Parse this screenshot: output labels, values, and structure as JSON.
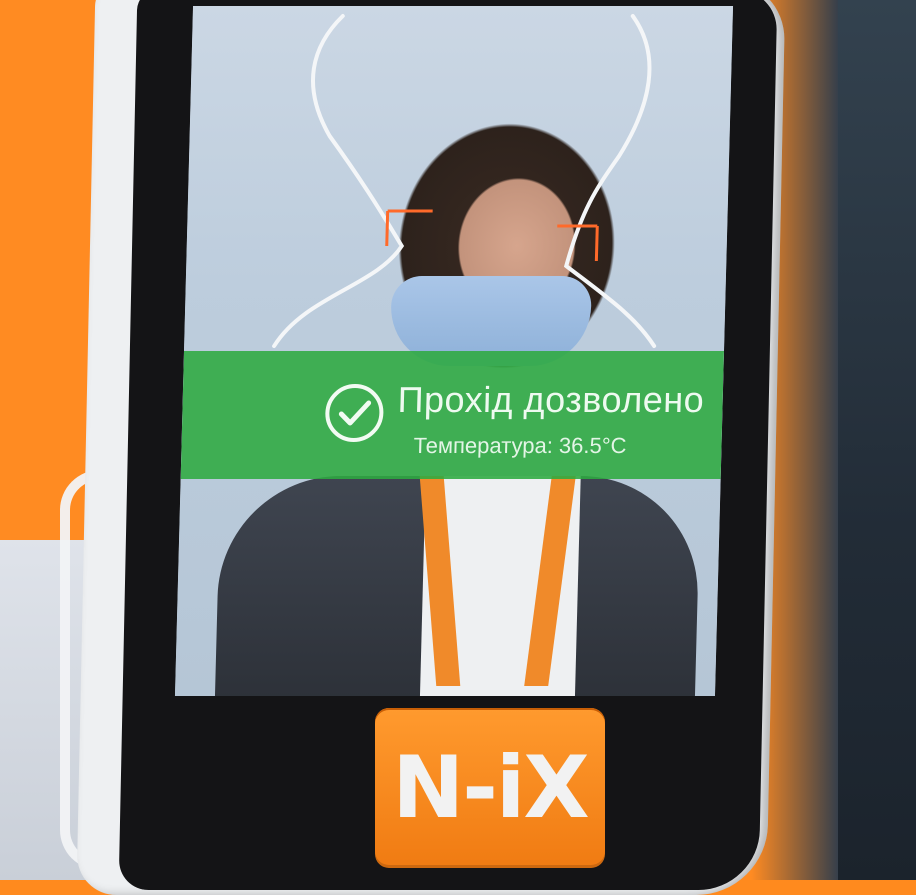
{
  "scene": {
    "accent_color": "#ff8a1e",
    "banner_color": "#2eaa40",
    "frame_color": "#ff6a2a"
  },
  "screen": {
    "status_title": "Прохід дозволено",
    "temperature_label": "Температура: 36.5°C",
    "status_icon": "check-circle-icon"
  },
  "device": {
    "brand_logo": "N-iX"
  }
}
